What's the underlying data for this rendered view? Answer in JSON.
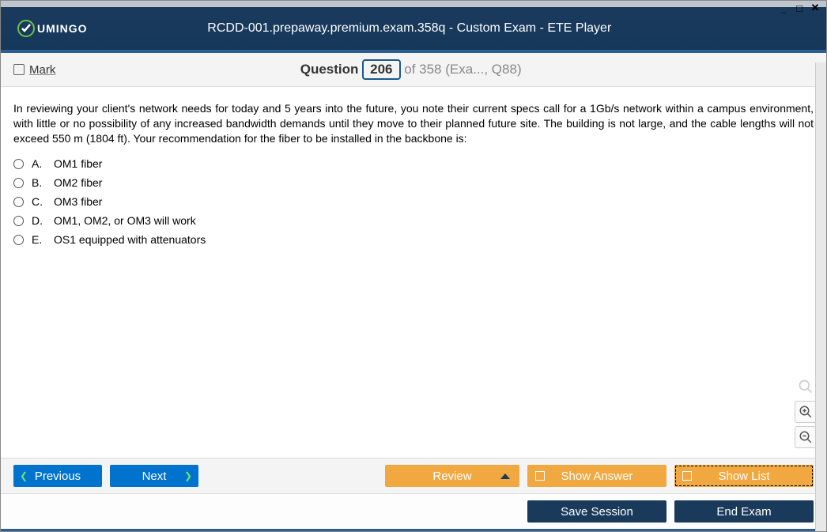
{
  "window": {
    "title": "RCDD-001.prepaway.premium.exam.358q - Custom Exam - ETE Player",
    "logo_text": "UMINGO"
  },
  "subheader": {
    "mark_label": "Mark",
    "question_word": "Question",
    "question_number": "206",
    "of_text": "of 358 (Exa..., Q88)"
  },
  "question": {
    "text": "In reviewing your client's network needs for today and 5 years into the future, you note their current specs call for a 1Gb/s network within a campus environment, with little or no possibility of any increased bandwidth demands until they move to their planned future site. The building is not large, and the cable lengths will not exceed 550 m (1804 ft). Your recommendation for the fiber to be installed in the backbone is:",
    "options": [
      {
        "letter": "A.",
        "text": "OM1 fiber"
      },
      {
        "letter": "B.",
        "text": "OM2 fiber"
      },
      {
        "letter": "C.",
        "text": "OM3 fiber"
      },
      {
        "letter": "D.",
        "text": "OM1, OM2, or OM3 will work"
      },
      {
        "letter": "E.",
        "text": "OS1 equipped with attenuators"
      }
    ]
  },
  "footer": {
    "previous": "Previous",
    "next": "Next",
    "review": "Review",
    "show_answer": "Show Answer",
    "show_list": "Show List",
    "save_session": "Save Session",
    "end_exam": "End Exam"
  }
}
